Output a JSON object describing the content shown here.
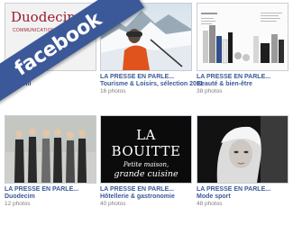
{
  "banner": {
    "label": "facebook",
    "color": "#3b5998"
  },
  "albums": [
    {
      "title": "...",
      "subtitle": "...o profil",
      "count": "",
      "thumb": {
        "kind": "logo",
        "logo_text": "Duodecim",
        "logo_sub": "COMMUNICATION – RE..."
      }
    },
    {
      "title": "LA PRESSE EN PARLE...",
      "subtitle": "Tourisme & Loisirs, sélection 2011",
      "count": "16 photos",
      "thumb": {
        "kind": "mountain"
      }
    },
    {
      "title": "LA PRESSE EN PARLE...",
      "subtitle": "Beauté & bien-être",
      "count": "38 photos",
      "thumb": {
        "kind": "products"
      }
    },
    {
      "title": "LA PRESSE EN PARLE...",
      "subtitle": "Duodecim",
      "count": "12 photos",
      "thumb": {
        "kind": "group"
      }
    },
    {
      "title": "LA PRESSE EN PARLE...",
      "subtitle": "Hôtellerie & gastronomie",
      "count": "40 photos",
      "thumb": {
        "kind": "text",
        "line1": "LA BOUITTE",
        "line2": "Petite maison,",
        "line3": "grande cuisine"
      }
    },
    {
      "title": "LA PRESSE EN PARLE...",
      "subtitle": "Mode sport",
      "count": "48 photos",
      "thumb": {
        "kind": "portrait"
      }
    }
  ],
  "colors": {
    "link": "#3b5998",
    "muted": "#808080",
    "logo": "#9b1b30"
  }
}
